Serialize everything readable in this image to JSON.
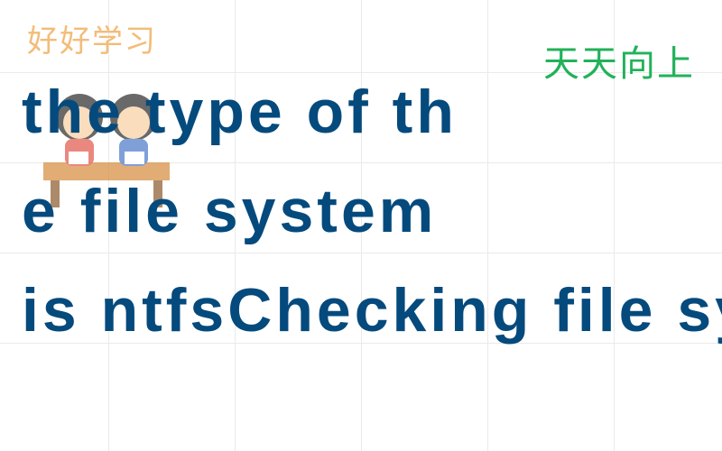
{
  "watermark": {
    "top_left_faded": "好好学习",
    "top_right_slogan": "天天向上"
  },
  "question": {
    "full_text": "the type of the file system is ntfsChecking file system on D",
    "line1": "the type of th",
    "line2": "e file system ",
    "line3": "is ntfsChecking file system on D"
  },
  "illustration": {
    "description": "cartoon-children-studying-at-desk"
  }
}
